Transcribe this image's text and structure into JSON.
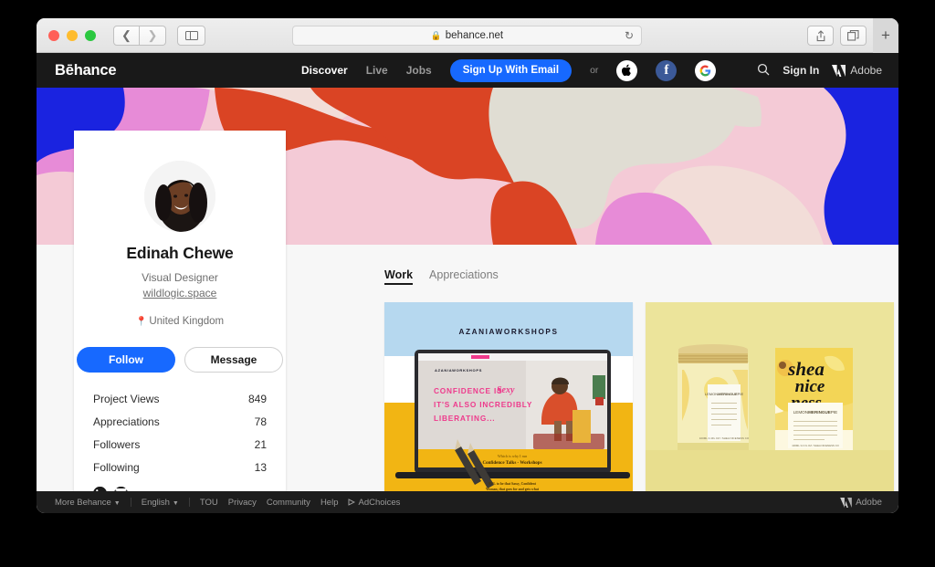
{
  "browser": {
    "url": "behance.net",
    "lock_icon": "lock-icon",
    "reload_icon": "reload-icon",
    "back_icon": "chevron-left-icon",
    "forward_icon": "chevron-right-icon",
    "sidebar_icon": "sidebar-toggle-icon",
    "share_icon": "share-icon",
    "tabs_icon": "tab-overview-icon",
    "new_tab_icon": "plus-icon"
  },
  "header": {
    "logo": "Bēhance",
    "nav": [
      {
        "label": "Discover",
        "active": true
      },
      {
        "label": "Live",
        "active": false
      },
      {
        "label": "Jobs",
        "active": false
      }
    ],
    "signup_button": "Sign Up With Email",
    "or_text": "or",
    "social_buttons": [
      {
        "name": "apple-signin-icon",
        "glyph": ""
      },
      {
        "name": "facebook-signin-icon",
        "glyph": "f"
      },
      {
        "name": "google-signin-icon",
        "glyph": "G"
      }
    ],
    "search_icon": "search-icon",
    "signin_label": "Sign In",
    "adobe_label": "Adobe",
    "adobe_icon": "adobe-logo-icon"
  },
  "hero": {
    "colors": {
      "blue": "#1a23e0",
      "pink": "#e78bd7",
      "light_pink": "#f4cad6",
      "orange": "#da4424",
      "cream": "#e0ddd3",
      "pale_pink": "#f2ddd8"
    }
  },
  "profile": {
    "avatar_name": "profile-avatar",
    "display_name": "Edinah Chewe",
    "occupation": "Visual Designer",
    "website": "wildlogic.space",
    "location": "United Kingdom",
    "location_icon": "location-pin-icon",
    "follow_button": "Follow",
    "message_button": "Message",
    "stats": [
      {
        "label": "Project Views",
        "value": "849"
      },
      {
        "label": "Appreciations",
        "value": "78"
      },
      {
        "label": "Followers",
        "value": "21"
      },
      {
        "label": "Following",
        "value": "13"
      }
    ],
    "social_links": [
      {
        "name": "linkedin-icon",
        "glyph": "in"
      },
      {
        "name": "dribbble-icon",
        "glyph": ""
      }
    ]
  },
  "work": {
    "tabs": [
      {
        "label": "Work",
        "active": true
      },
      {
        "label": "Appreciations",
        "active": false
      }
    ],
    "projects": [
      {
        "name": "project-azaniaworkshops",
        "title": "AZANIAWORKSHOPS",
        "headline_line1": "CONFIDENCE IS",
        "headline_script": "Sexy",
        "headline_line2": "IT'S ALSO INCREDIBLY",
        "headline_line3": "LIBERATING...",
        "caption_small": "Which is why I run",
        "caption_bold": "Confidence Talks - Workshops",
        "bg_color": "#b6d8ef",
        "accent_color": "#f2b513",
        "pink_color": "#ee3a8c"
      },
      {
        "name": "project-shea-niceness",
        "brand_line1": "shea",
        "brand_line2": "nice",
        "brand_line3": "ness",
        "product_label_prefix": "LEMON",
        "product_label_bold": "MERINGUE",
        "product_label_suffix": "PIE",
        "bg_color": "#ece49b",
        "lid_color": "#d8bf73"
      }
    ]
  },
  "footer": {
    "more_behance": "More Behance",
    "language": "English",
    "links": [
      "TOU",
      "Privacy",
      "Community",
      "Help"
    ],
    "adchoices": "AdChoices",
    "adchoices_icon": "adchoices-icon",
    "adobe_label": "Adobe",
    "adobe_icon": "adobe-logo-icon",
    "caret_icon": "chevron-down-icon"
  }
}
